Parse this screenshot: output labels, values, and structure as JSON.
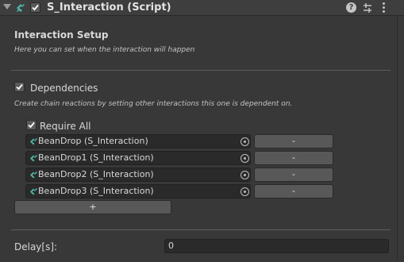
{
  "header": {
    "title": "S_Interaction (Script)",
    "enabled": true
  },
  "setup": {
    "title": "Interaction Setup",
    "subtitle": "Here you can set when the interaction will happen"
  },
  "dependencies": {
    "label": "Dependencies",
    "checked": true,
    "subtitle": "Create chain reactions by setting other interactions this one is dependent on.",
    "require_all_label": "Require All",
    "require_all_checked": true,
    "items": [
      {
        "name": "BeanDrop (S_Interaction)",
        "remove_label": "-"
      },
      {
        "name": "BeanDrop1 (S_Interaction)",
        "remove_label": "-"
      },
      {
        "name": "BeanDrop2 (S_Interaction)",
        "remove_label": "-"
      },
      {
        "name": "BeanDrop3 (S_Interaction)",
        "remove_label": "-"
      }
    ],
    "add_label": "+"
  },
  "delay": {
    "label": "Delay[s]:",
    "value": "0"
  },
  "icons": {
    "script": "script-icon",
    "help": "help-icon",
    "presets": "presets-icon",
    "menu": "menu-icon",
    "object": "interaction-object-icon",
    "picker": "object-picker-icon"
  },
  "colors": {
    "background": "#383838",
    "header": "#3e3e3e",
    "field": "#2a2a2a",
    "button": "#585858",
    "icon_accent": "#4fb6a8"
  }
}
